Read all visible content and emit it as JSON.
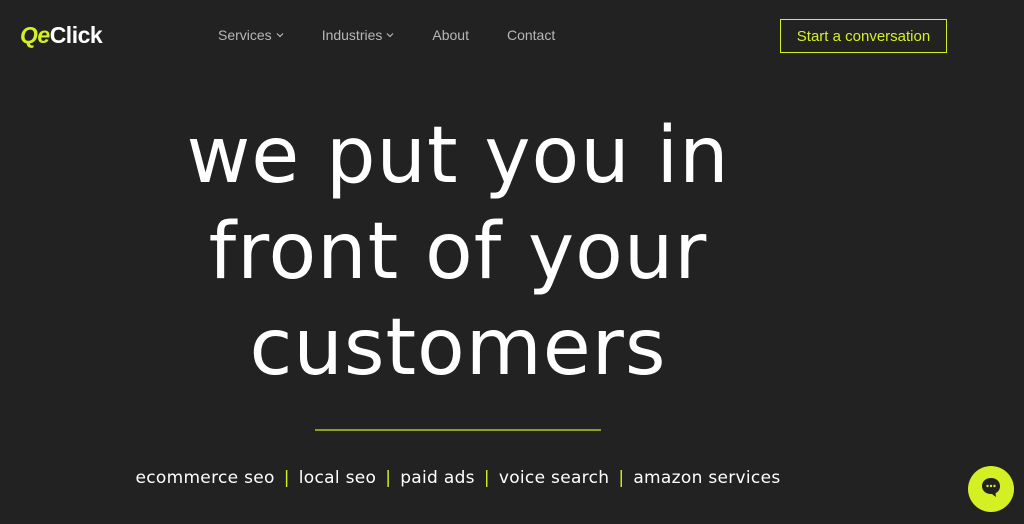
{
  "header": {
    "logo_mark": "Qe",
    "logo_word": "Click",
    "nav": [
      {
        "label": "Services",
        "has_dropdown": true
      },
      {
        "label": "Industries",
        "has_dropdown": true
      },
      {
        "label": "About",
        "has_dropdown": false
      },
      {
        "label": "Contact",
        "has_dropdown": false
      }
    ],
    "cta_label": "Start a conversation"
  },
  "hero": {
    "lines": [
      "we put you in",
      "front of your",
      "customers"
    ]
  },
  "services": [
    "ecommerce seo",
    "local seo",
    "paid ads",
    "voice search",
    "amazon services"
  ],
  "separator": "|",
  "colors": {
    "background": "#222222",
    "accent": "#d4f024",
    "text": "#ffffff",
    "nav_text": "#b7b7b7"
  },
  "chat": {
    "icon": "chat-bubble-icon"
  }
}
